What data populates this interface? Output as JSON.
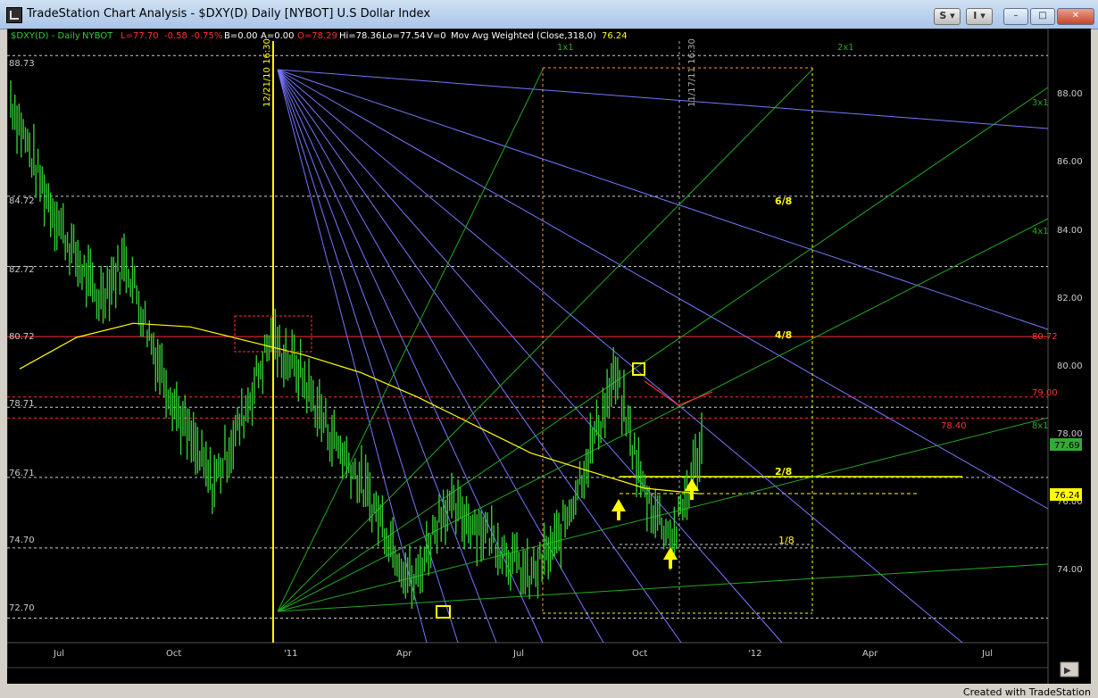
{
  "window": {
    "title": "TradeStation Chart Analysis - $DXY(D) Daily [NYBOT] U.S Dollar Index",
    "symbol_btn": "S",
    "indicator_btn": "I",
    "minimize": "–",
    "maximize": "□",
    "close": "✕"
  },
  "status": {
    "symbol": "$DXY(D) - Daily",
    "exchange": "NYBOT",
    "last": "L=77.70",
    "change": "-0.58",
    "pct": "-0.75%",
    "bid": "B=0.00",
    "ask": "A=0.00",
    "open": "O=78.29",
    "high": "Hi=78.36",
    "low": "Lo=77.54",
    "volume": "V=0",
    "study": "Mov Avg Weighted (Close,318,0)",
    "study_value": "76.24"
  },
  "colors": {
    "price": "#33cc33",
    "ma": "#ffff00",
    "gann_blue": "#7777ff",
    "gann_green": "#22aa22",
    "level_red": "#ff3030",
    "level_yellow": "#ffff00",
    "level_white": "#cccccc"
  },
  "left_levels": [
    "88.73",
    "84.72",
    "82.72",
    "80.72",
    "78.71",
    "76.71",
    "74.70",
    "72.70"
  ],
  "right_axis": [
    "88.00",
    "86.00",
    "84.00",
    "82.00",
    "80.00",
    "78.00",
    "76.00",
    "74.00"
  ],
  "right_badges": {
    "current": "77.69",
    "ma": "76.24"
  },
  "x_axis": [
    "Jul",
    "Oct",
    "'11",
    "Apr",
    "Jul",
    "Oct",
    "'12",
    "Apr",
    "Jul"
  ],
  "annotations": {
    "date_line_1": "12/21/10 16:30",
    "date_line_2": "11/17/11 16:30",
    "fraction_6_8": "6/8",
    "fraction_4_8": "4/8",
    "fraction_2_8": "2/8",
    "fraction_1_8": "1/8",
    "gann_1x1": "1x1",
    "gann_2x1": "2x1",
    "gann_3x1": "3x1",
    "gann_4x1": "4x1",
    "gann_8x1": "8x1",
    "red_80_72": "80.72",
    "red_79_00": "79.00",
    "red_78_40": "78.40"
  },
  "chart_data": {
    "type": "line",
    "title": "$DXY(D) Daily [NYBOT] U.S Dollar Index",
    "x": [
      "Jul",
      "Oct",
      "'11",
      "Apr",
      "Jul",
      "Oct",
      "'12",
      "Apr",
      "Jul"
    ],
    "series": [
      {
        "name": "$DXY(D)",
        "values": [
          87.5,
          85.2,
          83.4,
          81.8,
          82.9,
          80.3,
          78.2,
          76.5,
          78.3,
          80.6,
          79.8,
          78.1,
          76.8,
          75.3,
          73.6,
          75.9,
          75.5,
          74.8,
          73.8,
          74.9,
          77.2,
          79.6,
          76.3,
          74.9,
          77.7
        ]
      },
      {
        "name": "Mov Avg Weighted (Close,318,0)",
        "values": [
          79.8,
          80.7,
          81.1,
          81.0,
          80.6,
          80.2,
          79.7,
          79.0,
          78.2,
          77.4,
          76.9,
          76.4,
          76.24
        ]
      }
    ],
    "ylim": [
      72.0,
      89.5
    ]
  }
}
